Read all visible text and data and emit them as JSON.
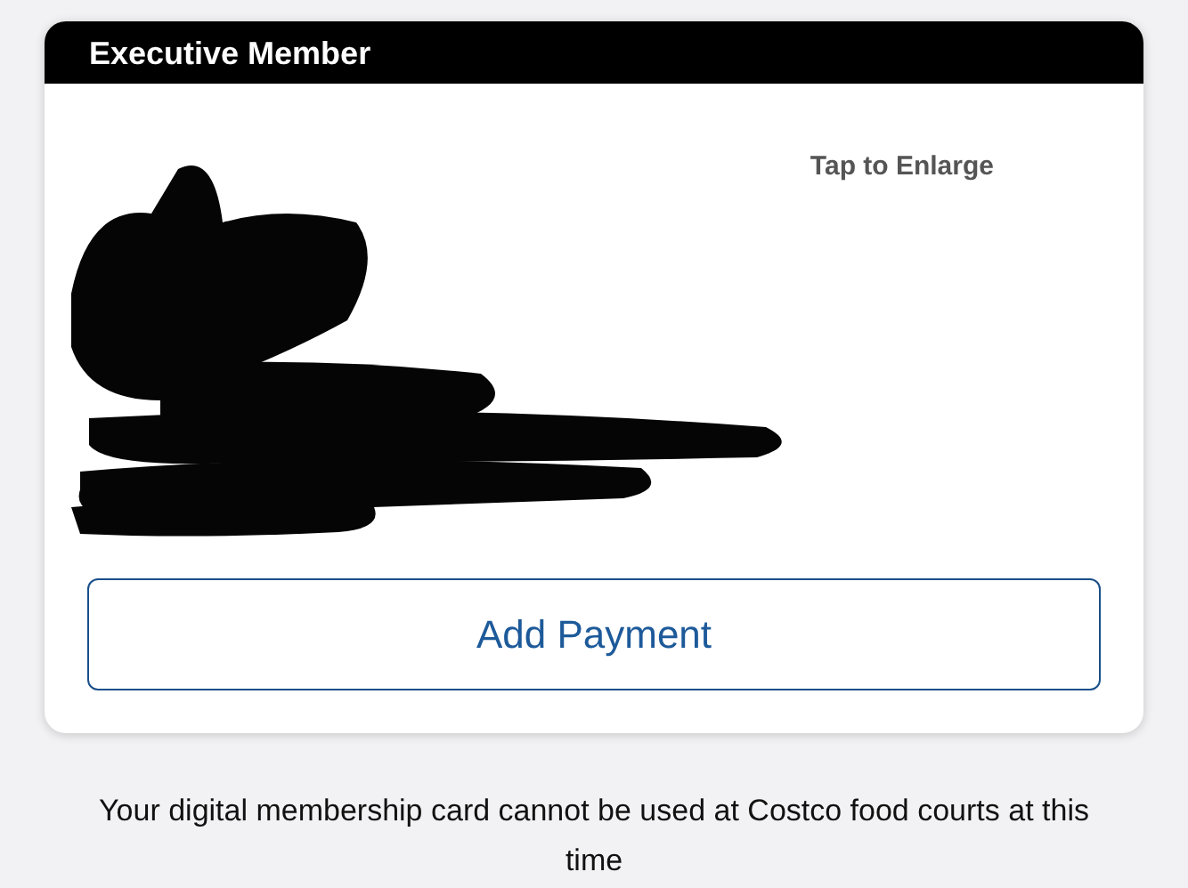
{
  "card": {
    "title": "Executive Member",
    "enlarge_hint": "Tap to Enlarge",
    "redacted": true,
    "action_button": "Add Payment"
  },
  "notice": "Your digital membership card cannot be used at Costco food courts at this time"
}
